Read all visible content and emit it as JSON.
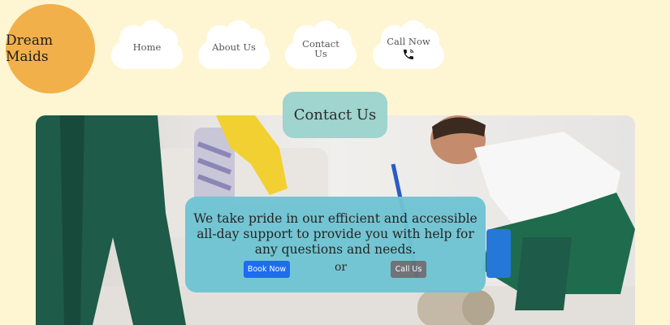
{
  "brand": {
    "name": "Dream Maids"
  },
  "nav": {
    "items": [
      {
        "label": "Home"
      },
      {
        "label": "About Us"
      },
      {
        "label": "Contact Us"
      },
      {
        "label": "Call Now"
      }
    ]
  },
  "main": {
    "title": "Contact Us",
    "message": "We take pride in our efficient and accessible all-day support to provide you with help for any questions and needs.",
    "book_button": "Book Now",
    "separator": "or",
    "call_button": "Call Us"
  },
  "colors": {
    "background": "#fef6d2",
    "logo": "#f2b04a",
    "title_box": "#9fd4cf",
    "info_box": "#6fc4d3",
    "book_button": "#1468f0",
    "call_button": "#6b6f73"
  },
  "icons": {
    "call": "phone-icon"
  }
}
